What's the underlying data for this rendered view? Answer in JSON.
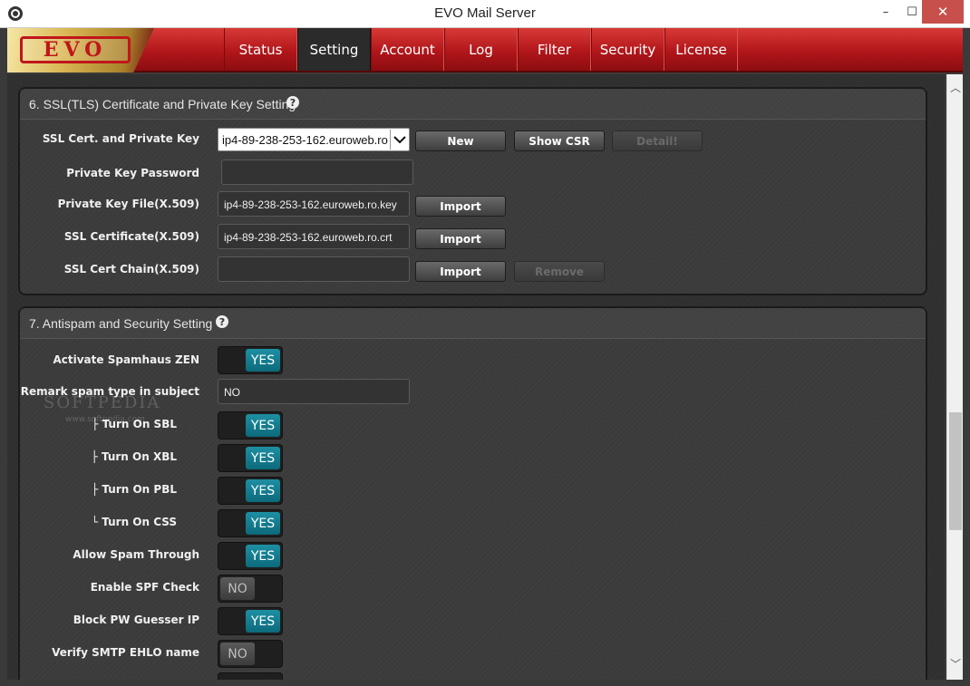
{
  "window": {
    "title": "EVO Mail Server",
    "min": "–",
    "max": "☐",
    "close": "✕"
  },
  "logo": {
    "text": "EVO"
  },
  "nav": [
    {
      "label": "Status"
    },
    {
      "label": "Setting",
      "active": true
    },
    {
      "label": "Account"
    },
    {
      "label": "Log"
    },
    {
      "label": "Filter"
    },
    {
      "label": "Security"
    },
    {
      "label": "License"
    }
  ],
  "ssl": {
    "title": "6. SSL(TLS) Certificate and Private Key Setting",
    "cert_label": "SSL Cert. and Private Key",
    "cert_value": "ip4-89-238-253-162.euroweb.ro",
    "new_btn": "New",
    "show_csr_btn": "Show CSR",
    "detail_btn": "Detail!",
    "pw_label": "Private Key Password",
    "pw_value": "",
    "keyfile_label": "Private Key File(X.509)",
    "keyfile_value": "ip4-89-238-253-162.euroweb.ro.key",
    "import_btn": "Import",
    "cert_file_label": "SSL Certificate(X.509)",
    "cert_file_value": "ip4-89-238-253-162.euroweb.ro.crt",
    "chain_label": "SSL Cert Chain(X.509)",
    "chain_value": "",
    "remove_btn": "Remove"
  },
  "antispam": {
    "title": "7. Antispam and Security Setting",
    "remark_label": "Remark spam type in subject",
    "remark_value": "NO",
    "toggles": [
      {
        "label": "Activate Spamhaus ZEN",
        "state": "YES"
      },
      {
        "label": "├ Turn On SBL",
        "state": "YES"
      },
      {
        "label": "├ Turn On XBL",
        "state": "YES"
      },
      {
        "label": "├ Turn On PBL",
        "state": "YES"
      },
      {
        "label": "└ Turn On CSS",
        "state": "YES"
      },
      {
        "label": "Allow Spam Through",
        "state": "YES"
      },
      {
        "label": "Enable SPF Check",
        "state": "NO"
      },
      {
        "label": "Block PW Guesser IP",
        "state": "YES"
      },
      {
        "label": "Verify SMTP EHLO name",
        "state": "NO"
      }
    ]
  },
  "watermark": {
    "text": "SOFTPEDIA",
    "sub": "www.softpedia.com"
  },
  "scroll": {
    "up": "︿",
    "down": "﹀"
  }
}
